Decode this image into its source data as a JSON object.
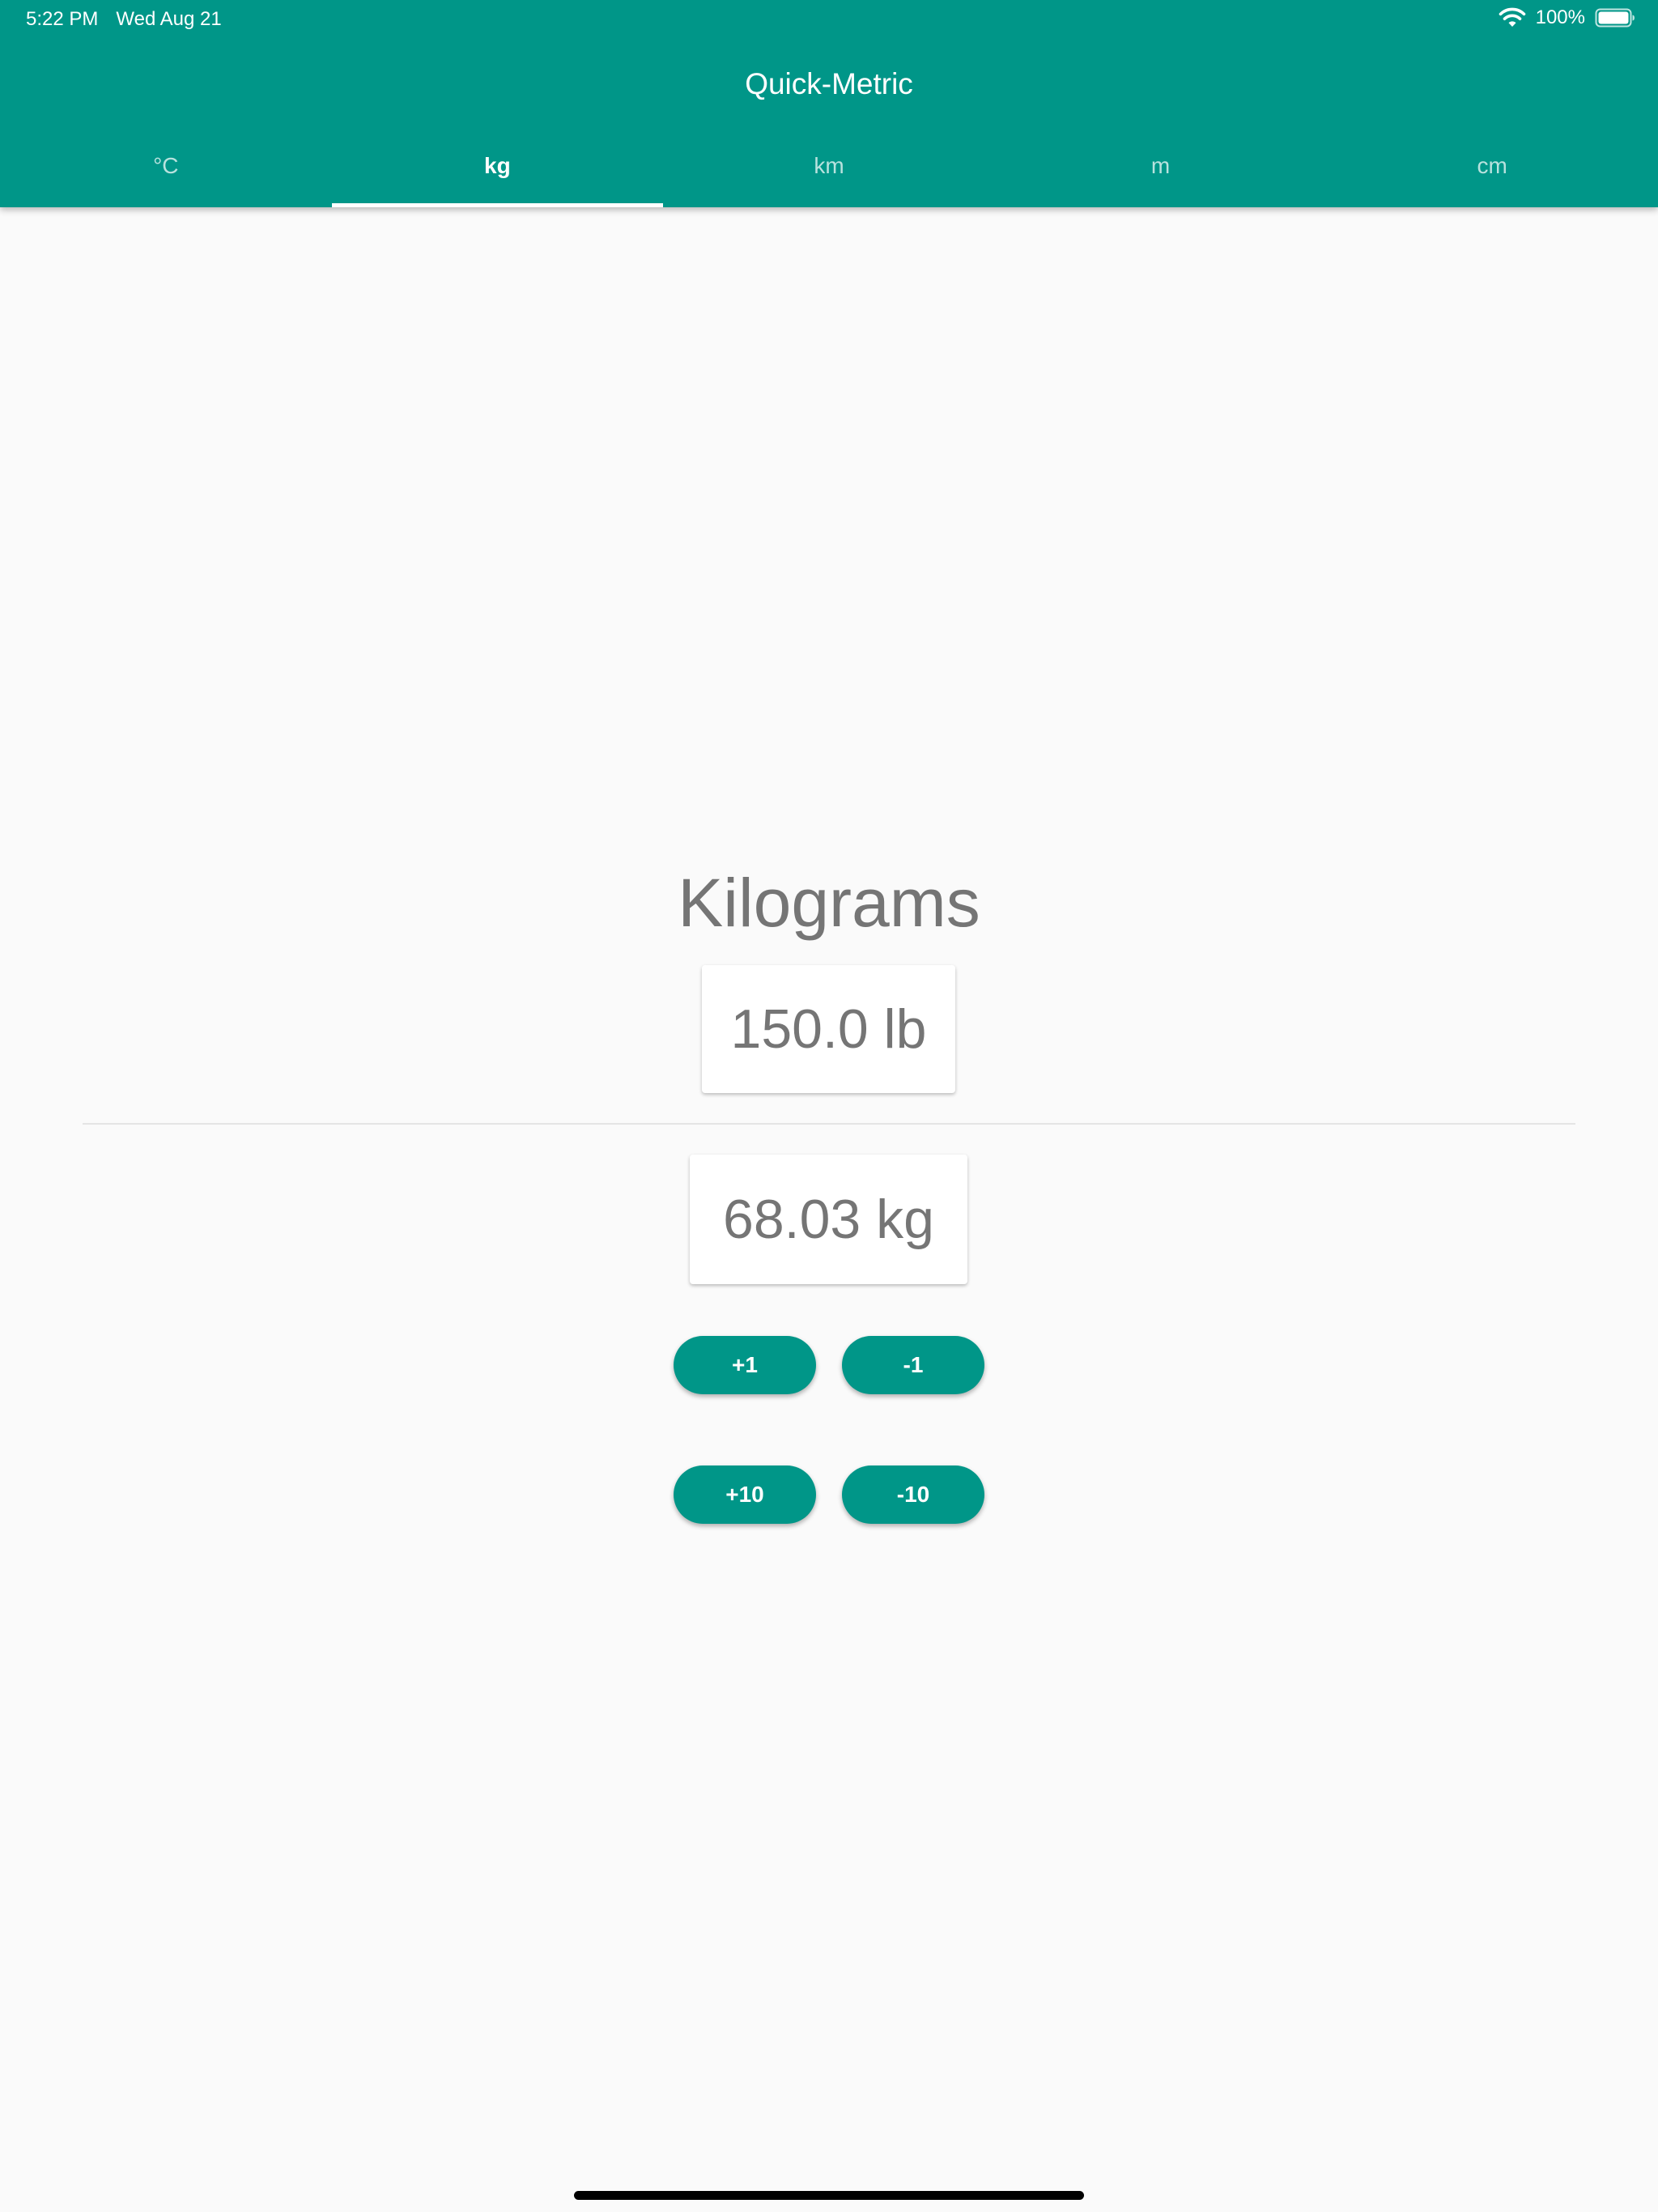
{
  "status_bar": {
    "time": "5:22 PM",
    "date": "Wed Aug 21",
    "battery": "100%",
    "wifi_icon": "wifi-icon",
    "battery_icon": "battery-icon"
  },
  "app": {
    "title": "Quick-Metric"
  },
  "tabs": [
    {
      "label": "°C",
      "active": false
    },
    {
      "label": "kg",
      "active": true
    },
    {
      "label": "km",
      "active": false
    },
    {
      "label": "m",
      "active": false
    },
    {
      "label": "cm",
      "active": false
    }
  ],
  "converter": {
    "heading": "Kilograms",
    "input_value": "150.0 lb",
    "result_value": "68.03 kg"
  },
  "buttons": {
    "plus_one": "+1",
    "minus_one": "-1",
    "plus_ten": "+10",
    "minus_ten": "-10"
  },
  "colors": {
    "primary": "#009688",
    "background": "#fafafa",
    "text_gray": "#757575"
  }
}
